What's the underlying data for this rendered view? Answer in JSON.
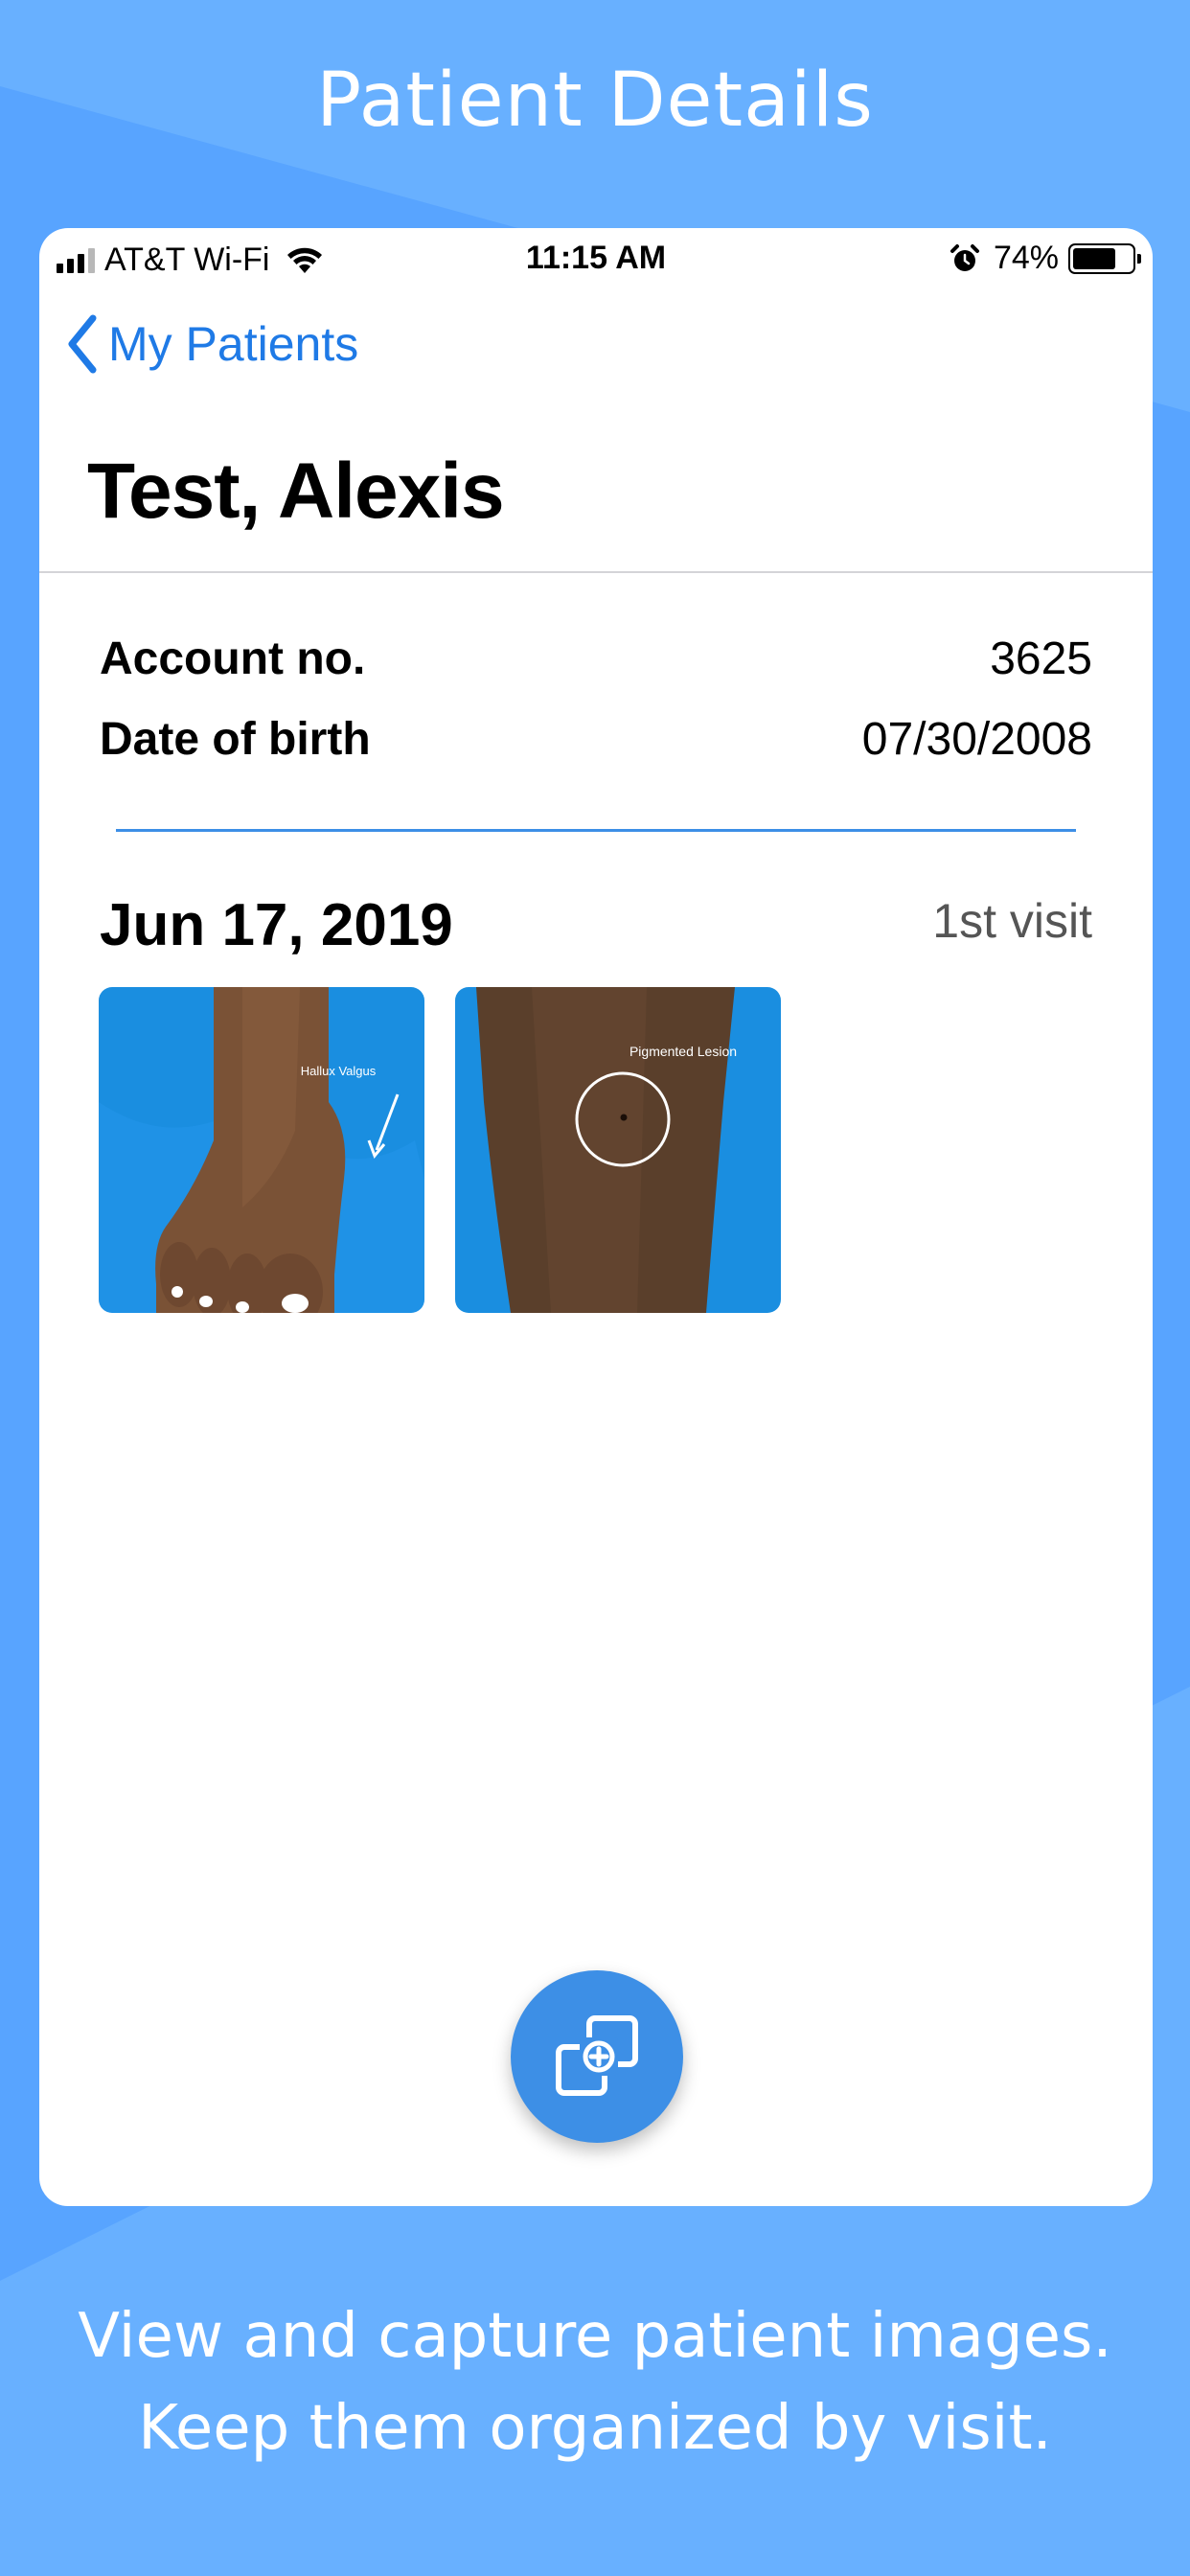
{
  "headline": "Patient Details",
  "caption": {
    "line1": "View and capture patient images.",
    "line2": "Keep them organized by visit."
  },
  "status_bar": {
    "carrier": "AT&T Wi-Fi",
    "time": "11:15 AM",
    "battery_percent": "74%",
    "battery_level": 0.74,
    "icons": [
      "cellular-signal-icon",
      "wifi-icon",
      "alarm-icon",
      "battery-icon"
    ]
  },
  "nav": {
    "back_label": "My Patients",
    "back_icon": "chevron-left-icon"
  },
  "patient": {
    "name": "Test, Alexis",
    "account_label": "Account no.",
    "account_value": "3625",
    "dob_label": "Date of birth",
    "dob_value": "07/30/2008"
  },
  "visit": {
    "date": "Jun 17, 2019",
    "number": "1st visit",
    "images": [
      {
        "annotation": "Hallux Valgus"
      },
      {
        "annotation": "Pigmented Lesion"
      }
    ]
  },
  "fab": {
    "icon": "add-photo-icon"
  },
  "colors": {
    "background": "#68b0ff",
    "accent": "#3d8fe6",
    "link": "#1f7ae6",
    "photo_bg": "#1a8ee0"
  }
}
